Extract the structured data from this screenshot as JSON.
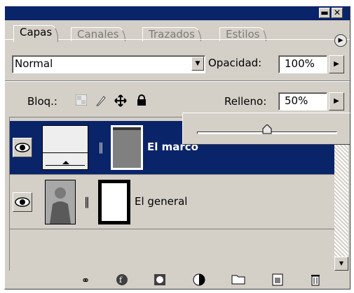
{
  "window": {
    "minimize_glyph": "▬",
    "close_glyph": "✕"
  },
  "tabs": [
    {
      "label": "Capas",
      "active": true
    },
    {
      "label": "Canales",
      "active": false
    },
    {
      "label": "Trazados",
      "active": false
    },
    {
      "label": "Estilos",
      "active": false
    }
  ],
  "controls": {
    "blend_mode": "Normal",
    "opacity_label": "Opacidad:",
    "opacity_value": "100%",
    "lock_label": "Bloq.:",
    "fill_label": "Relleno:",
    "fill_value": "50%",
    "fill_slider_fraction": 0.5
  },
  "layers": [
    {
      "name": "El marco",
      "selected": true,
      "visible": true
    },
    {
      "name": "El general",
      "selected": false,
      "visible": true
    }
  ],
  "icons": {
    "eye": "eye-icon",
    "chain": "link-icon",
    "lock_transparency": "checker-icon",
    "lock_paint": "brush-icon",
    "lock_move": "move-icon",
    "lock_all": "padlock-icon"
  },
  "colors": {
    "selection": "#0a246a",
    "panel": "#d4d0c8"
  }
}
